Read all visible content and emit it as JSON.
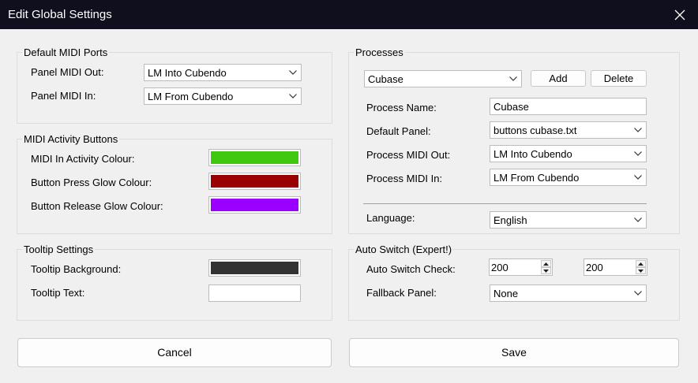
{
  "window": {
    "title": "Edit Global Settings"
  },
  "default_midi_ports": {
    "title": "Default MIDI Ports",
    "panel_out_label": "Panel MIDI Out:",
    "panel_out_value": "LM Into Cubendo",
    "panel_in_label": "Panel MIDI In:",
    "panel_in_value": "LM From Cubendo"
  },
  "midi_activity": {
    "title": "MIDI Activity Buttons",
    "items": [
      {
        "label": "MIDI In Activity Colour:",
        "color": "#3fc80f"
      },
      {
        "label": "Button Press Glow Colour:",
        "color": "#990000"
      },
      {
        "label": "Button Release Glow Colour:",
        "color": "#9900ff"
      }
    ]
  },
  "tooltip": {
    "title": "Tooltip Settings",
    "background_label": "Tooltip Background:",
    "background_color": "#333333",
    "text_label": "Tooltip Text:",
    "text_color": "#ffffff"
  },
  "processes": {
    "title": "Processes",
    "selected": "Cubase",
    "add_label": "Add",
    "delete_label": "Delete",
    "name_label": "Process Name:",
    "name_value": "Cubase",
    "panel_label": "Default Panel:",
    "panel_value": "buttons cubase.txt",
    "out_label": "Process MIDI Out:",
    "out_value": "LM Into Cubendo",
    "in_label": "Process MIDI In:",
    "in_value": "LM From Cubendo",
    "language_label": "Language:",
    "language_value": "English"
  },
  "auto_switch": {
    "title": "Auto Switch (Expert!)",
    "check_label": "Auto Switch Check:",
    "check_value_1": "200",
    "check_value_2": "200",
    "fallback_label": "Fallback Panel:",
    "fallback_value": "None"
  },
  "footer": {
    "cancel_label": "Cancel",
    "save_label": "Save"
  }
}
